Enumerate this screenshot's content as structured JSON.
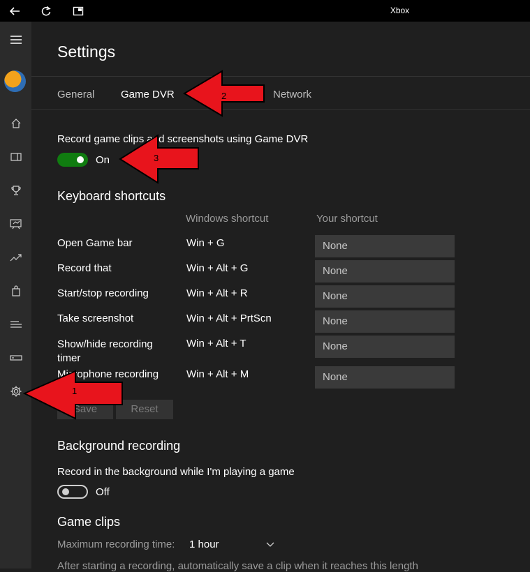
{
  "titlebar": {
    "title": "Xbox"
  },
  "settings": {
    "title": "Settings",
    "tabs": [
      "General",
      "Game DVR",
      "Network"
    ],
    "record_label": "Record game clips and screenshots using Game DVR",
    "record_toggle_state": "On",
    "keyboard_heading": "Keyboard shortcuts",
    "col_windows": "Windows shortcut",
    "col_yours": "Your shortcut",
    "shortcuts": [
      {
        "action": "Open Game bar",
        "windows": "Win + G",
        "yours": "None"
      },
      {
        "action": "Record that",
        "windows": "Win + Alt + G",
        "yours": "None"
      },
      {
        "action": "Start/stop recording",
        "windows": "Win + Alt + R",
        "yours": "None"
      },
      {
        "action": "Take screenshot",
        "windows": "Win + Alt + PrtScn",
        "yours": "None"
      },
      {
        "action": "Show/hide recording timer",
        "windows": "Win + Alt + T",
        "yours": "None"
      },
      {
        "action": "Microphone recording",
        "windows": "Win + Alt + M",
        "yours": "None"
      }
    ],
    "save_label": "Save",
    "reset_label": "Reset",
    "background_heading": "Background recording",
    "background_label": "Record in the background while I'm playing a game",
    "background_toggle_state": "Off",
    "clips_heading": "Game clips",
    "max_time_label": "Maximum recording time:",
    "max_time_value": "1 hour",
    "auto_save_text": "After starting a recording, automatically save a clip when it reaches this length"
  },
  "annotations": [
    "1",
    "2",
    "3"
  ],
  "colors": {
    "toggle_on": "#107c10",
    "arrow": "#e8141c",
    "background": "#1f1f1f",
    "sidebar": "#2b2b2b"
  }
}
